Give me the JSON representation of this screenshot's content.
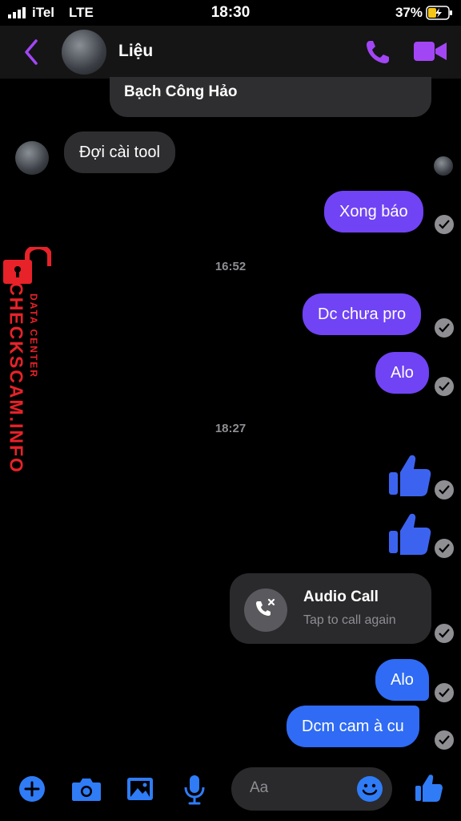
{
  "status_bar": {
    "carrier": "iTel",
    "network": "LTE",
    "time": "18:30",
    "battery_pct": "37%"
  },
  "header": {
    "contact_name": "Liệu",
    "icons": [
      "back-chevron-icon",
      "phone-icon",
      "video-camera-icon"
    ],
    "accent_color": "#a246f5"
  },
  "messages": {
    "top_reply_preview": "Bạch Công Hảo",
    "m1": "Đợi cài tool",
    "m2": "Xong báo",
    "ts1": "16:52",
    "m3": "Dc chưa pro",
    "m4": "Alo",
    "ts2": "18:27",
    "call_title": "Audio Call",
    "call_subtitle": "Tap to call again",
    "m5": "Alo",
    "m6": "Dcm cam à cu"
  },
  "composer": {
    "placeholder": "Aa",
    "icons": [
      "plus-icon",
      "camera-icon",
      "image-icon",
      "microphone-icon",
      "emoji-icon",
      "thumbs-up-icon"
    ],
    "accent_color": "#2f7cf6"
  },
  "watermark": {
    "brand": "CHECKSCAM.INFO",
    "tagline": "DATA CENTER",
    "color": "#e82229"
  },
  "colors": {
    "sent_purple": "#7043f5",
    "sent_blue": "#2f6bf4",
    "received": "#2e2e30"
  }
}
